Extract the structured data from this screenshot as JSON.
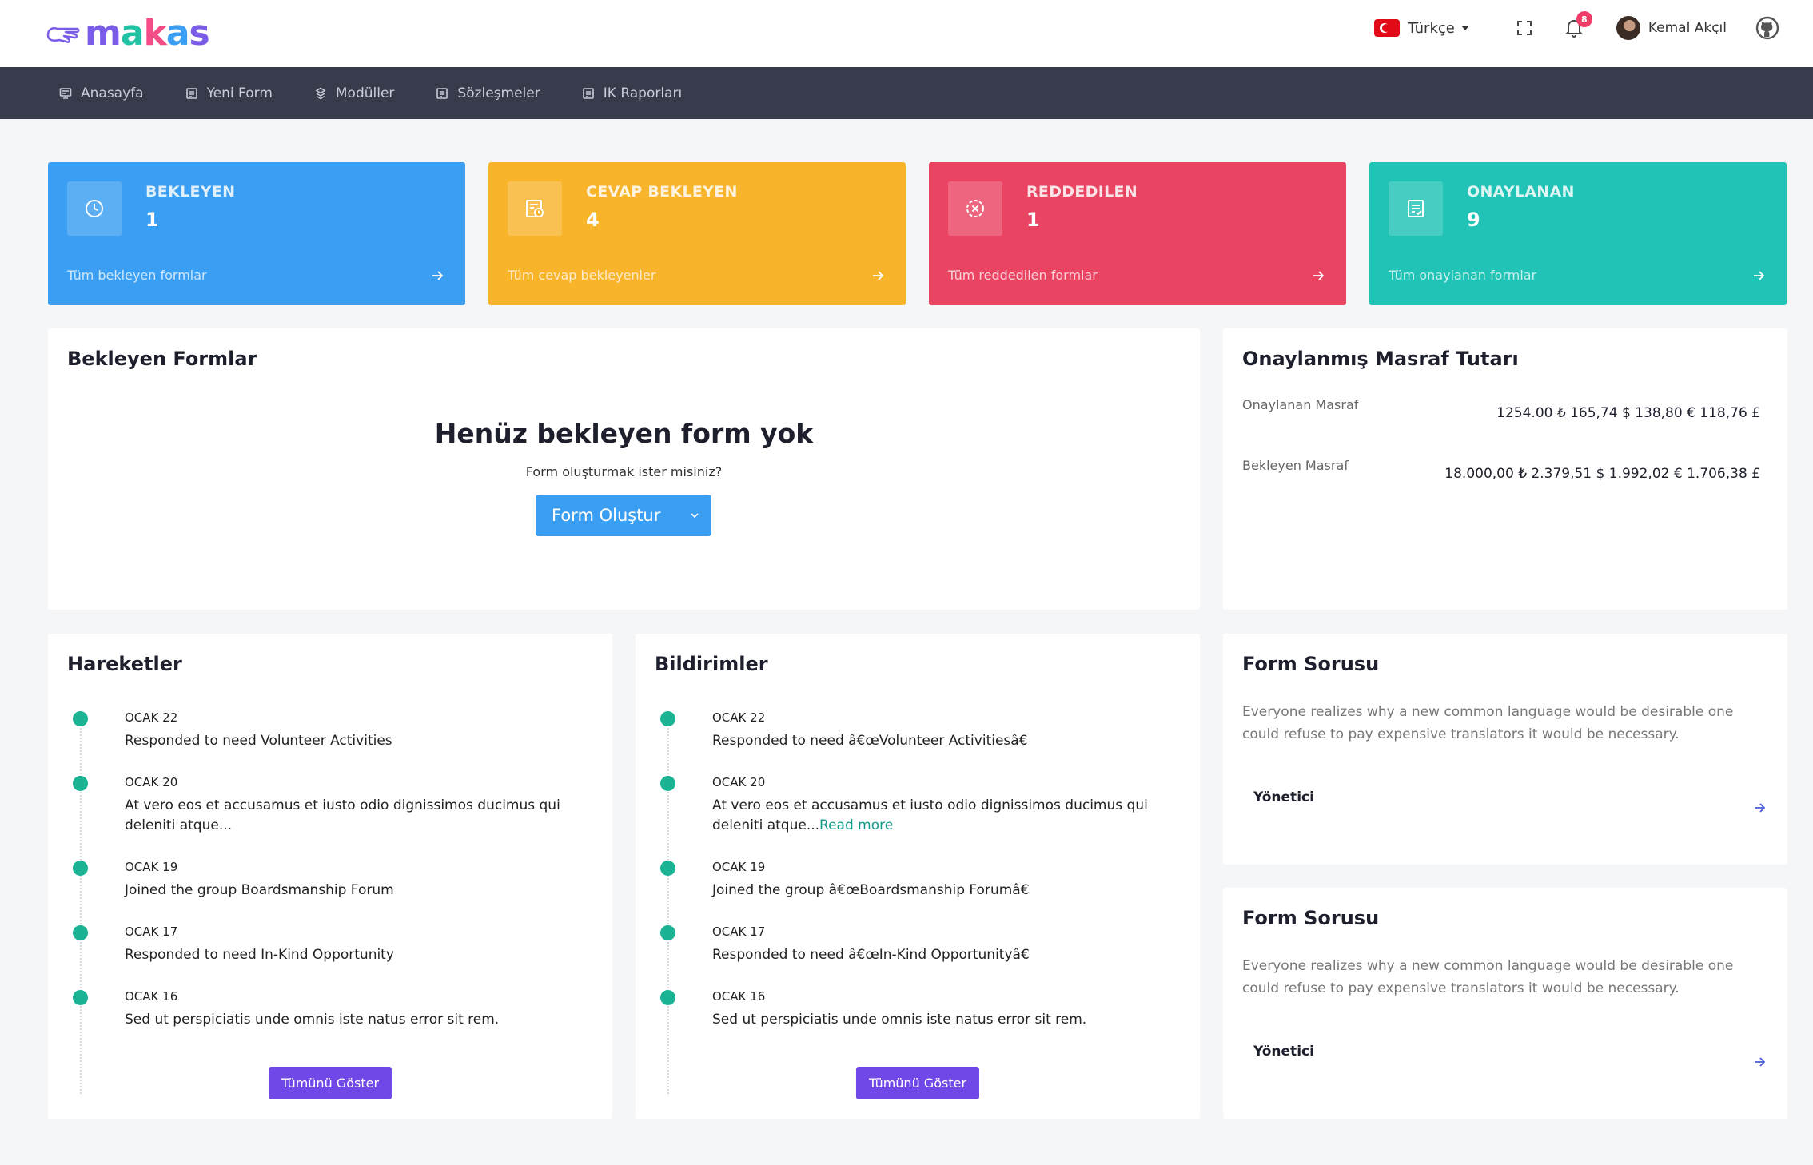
{
  "brand": {
    "name": "makas"
  },
  "header": {
    "language": "Türkçe",
    "notifications_count": "8",
    "user_name": "Kemal Akçıl"
  },
  "nav": {
    "items": [
      {
        "label": "Anasayfa",
        "icon": "monitor-icon"
      },
      {
        "label": "Yeni Form",
        "icon": "form-icon"
      },
      {
        "label": "Modüller",
        "icon": "layers-icon"
      },
      {
        "label": "Sözleşmeler",
        "icon": "form-icon"
      },
      {
        "label": "IK Raporları",
        "icon": "form-icon"
      }
    ]
  },
  "stats": [
    {
      "title": "BEKLEYEN",
      "count": "1",
      "link": "Tüm bekleyen formlar",
      "color": "#3a9ef2",
      "icon": "clock-icon"
    },
    {
      "title": "CEVAP BEKLEYEN",
      "count": "4",
      "link": "Tüm cevap bekleyenler",
      "color": "#f8b42b",
      "icon": "form-clock-icon"
    },
    {
      "title": "REDDEDILEN",
      "count": "1",
      "link": "Tüm reddedilen formlar",
      "color": "#ea4463",
      "icon": "x-circle-icon"
    },
    {
      "title": "ONAYLANAN",
      "count": "9",
      "link": "Tüm onaylanan formlar",
      "color": "#20c3b5",
      "icon": "checklist-icon"
    }
  ],
  "pending_forms": {
    "title": "Bekleyen Formlar",
    "empty_title": "Henüz bekleyen form yok",
    "empty_subtitle": "Form oluşturmak ister misiniz?",
    "button_label": "Form Oluştur"
  },
  "expenses": {
    "title": "Onaylanmış Masraf Tutarı",
    "rows": [
      {
        "label": "Onaylanan Masraf",
        "values": "1254.00 ₺  165,74 $  138,80 €  118,76 £"
      },
      {
        "label": "Bekleyen Masraf",
        "values": "18.000,00 ₺  2.379,51 $  1.992,02 €  1.706,38 £"
      }
    ]
  },
  "activities": {
    "title": "Hareketler",
    "items": [
      {
        "date": "OCAK 22",
        "text": "Responded to need Volunteer Activities"
      },
      {
        "date": "OCAK 20",
        "text": "At vero eos et accusamus et iusto odio dignissimos ducimus qui deleniti atque..."
      },
      {
        "date": "OCAK 19",
        "text": "Joined the group Boardsmanship Forum"
      },
      {
        "date": "OCAK 17",
        "text": "Responded to need In-Kind Opportunity"
      },
      {
        "date": "OCAK 16",
        "text": "Sed ut perspiciatis unde omnis iste natus error sit rem."
      }
    ],
    "button_label": "Tümünü Göster"
  },
  "notifications": {
    "title": "Bildirimler",
    "items": [
      {
        "date": "OCAK 22",
        "text": "Responded to need â€œVolunteer Activitiesâ€"
      },
      {
        "date": "OCAK 20",
        "text": "At vero eos et accusamus et iusto odio dignissimos ducimus qui deleniti atque...",
        "link": "Read more"
      },
      {
        "date": "OCAK 19",
        "text": "Joined the group â€œBoardsmanship Forumâ€"
      },
      {
        "date": "OCAK 17",
        "text": "Responded to need â€œIn-Kind Opportunityâ€"
      },
      {
        "date": "OCAK 16",
        "text": "Sed ut perspiciatis unde omnis iste natus error sit rem."
      }
    ],
    "button_label": "Tümünü Göster"
  },
  "form_questions": [
    {
      "title": "Form Sorusu",
      "body": "Everyone realizes why a new common language would be desirable one could refuse to pay expensive translators it would be necessary.",
      "role": "Yönetici"
    },
    {
      "title": "Form Sorusu",
      "body": "Everyone realizes why a new common language would be desirable one could refuse to pay expensive translators it would be necessary.",
      "role": "Yönetici"
    }
  ]
}
